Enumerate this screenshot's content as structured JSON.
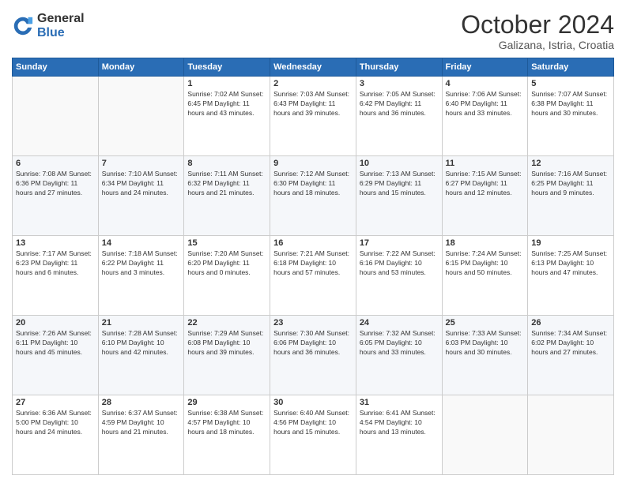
{
  "logo": {
    "general": "General",
    "blue": "Blue"
  },
  "header": {
    "month": "October 2024",
    "location": "Galizana, Istria, Croatia"
  },
  "days_of_week": [
    "Sunday",
    "Monday",
    "Tuesday",
    "Wednesday",
    "Thursday",
    "Friday",
    "Saturday"
  ],
  "weeks": [
    [
      {
        "day": "",
        "content": ""
      },
      {
        "day": "",
        "content": ""
      },
      {
        "day": "1",
        "content": "Sunrise: 7:02 AM\nSunset: 6:45 PM\nDaylight: 11 hours and 43 minutes."
      },
      {
        "day": "2",
        "content": "Sunrise: 7:03 AM\nSunset: 6:43 PM\nDaylight: 11 hours and 39 minutes."
      },
      {
        "day": "3",
        "content": "Sunrise: 7:05 AM\nSunset: 6:42 PM\nDaylight: 11 hours and 36 minutes."
      },
      {
        "day": "4",
        "content": "Sunrise: 7:06 AM\nSunset: 6:40 PM\nDaylight: 11 hours and 33 minutes."
      },
      {
        "day": "5",
        "content": "Sunrise: 7:07 AM\nSunset: 6:38 PM\nDaylight: 11 hours and 30 minutes."
      }
    ],
    [
      {
        "day": "6",
        "content": "Sunrise: 7:08 AM\nSunset: 6:36 PM\nDaylight: 11 hours and 27 minutes."
      },
      {
        "day": "7",
        "content": "Sunrise: 7:10 AM\nSunset: 6:34 PM\nDaylight: 11 hours and 24 minutes."
      },
      {
        "day": "8",
        "content": "Sunrise: 7:11 AM\nSunset: 6:32 PM\nDaylight: 11 hours and 21 minutes."
      },
      {
        "day": "9",
        "content": "Sunrise: 7:12 AM\nSunset: 6:30 PM\nDaylight: 11 hours and 18 minutes."
      },
      {
        "day": "10",
        "content": "Sunrise: 7:13 AM\nSunset: 6:29 PM\nDaylight: 11 hours and 15 minutes."
      },
      {
        "day": "11",
        "content": "Sunrise: 7:15 AM\nSunset: 6:27 PM\nDaylight: 11 hours and 12 minutes."
      },
      {
        "day": "12",
        "content": "Sunrise: 7:16 AM\nSunset: 6:25 PM\nDaylight: 11 hours and 9 minutes."
      }
    ],
    [
      {
        "day": "13",
        "content": "Sunrise: 7:17 AM\nSunset: 6:23 PM\nDaylight: 11 hours and 6 minutes."
      },
      {
        "day": "14",
        "content": "Sunrise: 7:18 AM\nSunset: 6:22 PM\nDaylight: 11 hours and 3 minutes."
      },
      {
        "day": "15",
        "content": "Sunrise: 7:20 AM\nSunset: 6:20 PM\nDaylight: 11 hours and 0 minutes."
      },
      {
        "day": "16",
        "content": "Sunrise: 7:21 AM\nSunset: 6:18 PM\nDaylight: 10 hours and 57 minutes."
      },
      {
        "day": "17",
        "content": "Sunrise: 7:22 AM\nSunset: 6:16 PM\nDaylight: 10 hours and 53 minutes."
      },
      {
        "day": "18",
        "content": "Sunrise: 7:24 AM\nSunset: 6:15 PM\nDaylight: 10 hours and 50 minutes."
      },
      {
        "day": "19",
        "content": "Sunrise: 7:25 AM\nSunset: 6:13 PM\nDaylight: 10 hours and 47 minutes."
      }
    ],
    [
      {
        "day": "20",
        "content": "Sunrise: 7:26 AM\nSunset: 6:11 PM\nDaylight: 10 hours and 45 minutes."
      },
      {
        "day": "21",
        "content": "Sunrise: 7:28 AM\nSunset: 6:10 PM\nDaylight: 10 hours and 42 minutes."
      },
      {
        "day": "22",
        "content": "Sunrise: 7:29 AM\nSunset: 6:08 PM\nDaylight: 10 hours and 39 minutes."
      },
      {
        "day": "23",
        "content": "Sunrise: 7:30 AM\nSunset: 6:06 PM\nDaylight: 10 hours and 36 minutes."
      },
      {
        "day": "24",
        "content": "Sunrise: 7:32 AM\nSunset: 6:05 PM\nDaylight: 10 hours and 33 minutes."
      },
      {
        "day": "25",
        "content": "Sunrise: 7:33 AM\nSunset: 6:03 PM\nDaylight: 10 hours and 30 minutes."
      },
      {
        "day": "26",
        "content": "Sunrise: 7:34 AM\nSunset: 6:02 PM\nDaylight: 10 hours and 27 minutes."
      }
    ],
    [
      {
        "day": "27",
        "content": "Sunrise: 6:36 AM\nSunset: 5:00 PM\nDaylight: 10 hours and 24 minutes."
      },
      {
        "day": "28",
        "content": "Sunrise: 6:37 AM\nSunset: 4:59 PM\nDaylight: 10 hours and 21 minutes."
      },
      {
        "day": "29",
        "content": "Sunrise: 6:38 AM\nSunset: 4:57 PM\nDaylight: 10 hours and 18 minutes."
      },
      {
        "day": "30",
        "content": "Sunrise: 6:40 AM\nSunset: 4:56 PM\nDaylight: 10 hours and 15 minutes."
      },
      {
        "day": "31",
        "content": "Sunrise: 6:41 AM\nSunset: 4:54 PM\nDaylight: 10 hours and 13 minutes."
      },
      {
        "day": "",
        "content": ""
      },
      {
        "day": "",
        "content": ""
      }
    ]
  ]
}
